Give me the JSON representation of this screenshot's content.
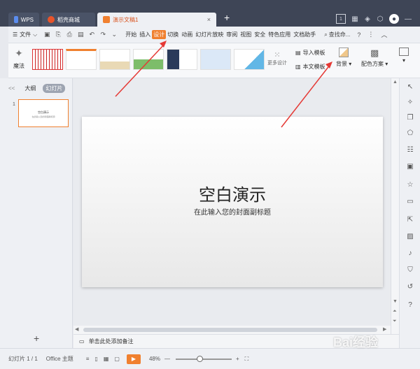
{
  "titlebar": {
    "tabs": [
      {
        "label": "WPS"
      },
      {
        "label": "稻壳商城"
      },
      {
        "label": "演示文稿1"
      }
    ],
    "new_tab": "+",
    "page_badge": "1"
  },
  "menubar": {
    "file_label": "文件",
    "items": [
      "开始",
      "插入",
      "设计",
      "切换",
      "动画",
      "幻灯片放映",
      "审阅",
      "视图",
      "安全",
      "特色应用",
      "文档助手"
    ],
    "active_item": "设计",
    "search_label": "查找命...",
    "help": "?"
  },
  "ribbon": {
    "magic_label": "魔法",
    "more_design": "更多设计",
    "import_template": "导入模板",
    "this_template": "本文模板",
    "background": "背景",
    "color_scheme": "配色方案"
  },
  "leftpanel": {
    "tab_outline": "大纲",
    "tab_slides": "幻灯片",
    "collapse": "<<",
    "thumb_number": "1",
    "thumb_title": "空白演示",
    "thumb_sub": "在此输入您的封面副标题",
    "add": "+"
  },
  "slide": {
    "title": "空白演示",
    "subtitle": "在此输入您的封面副标题"
  },
  "notes": {
    "placeholder": "单击此处添加备注"
  },
  "statusbar": {
    "slide_count": "幻灯片 1 / 1",
    "theme": "Office 主题",
    "zoom": "48%",
    "minus": "—",
    "plus": "+"
  },
  "watermark": "Bai经验",
  "colors": {
    "titlebar": "#3e4556",
    "accent": "#f0802f",
    "arrow": "#e53935"
  }
}
